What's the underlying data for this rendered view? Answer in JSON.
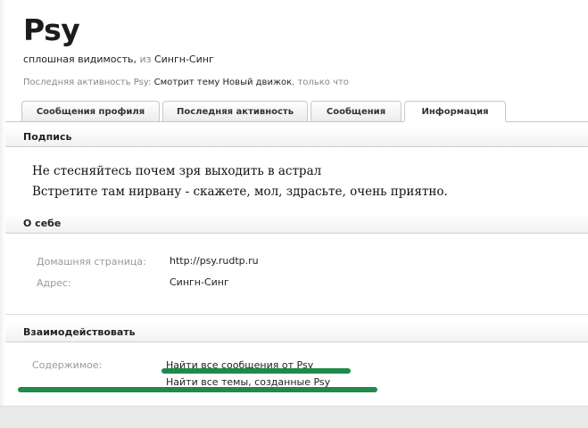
{
  "profile": {
    "username": "Psy",
    "status": "сплошная видимость",
    "from_prefix": "из",
    "location": "Сингн-Синг",
    "last_activity_prefix": "Последняя активность Psy:",
    "last_activity_text": "Смотрит тему Новый движок",
    "last_activity_time": "только что"
  },
  "tabs": [
    {
      "label": "Сообщения профиля",
      "active": false
    },
    {
      "label": "Последняя активность",
      "active": false
    },
    {
      "label": "Сообщения",
      "active": false
    },
    {
      "label": "Информация",
      "active": true
    }
  ],
  "signature": {
    "title": "Подпись",
    "line1": "Не стесняйтесь почем зря выходить в астрал",
    "line2": "Встретите там нирвану - скажете, мол, здрасьте, очень приятно."
  },
  "about": {
    "title": "О себе",
    "homepage_label": "Домашняя страница:",
    "homepage_value": "http://psy.rudtp.ru",
    "address_label": "Адрес:",
    "address_value": "Сингн-Синг"
  },
  "interact": {
    "title": "Взаимодействовать",
    "content_label": "Содержимое:",
    "find_posts": "Найти все сообщения от Psy",
    "find_threads": "Найти все темы, созданные Psy"
  },
  "colors": {
    "marker_green": "#1f8a4c"
  }
}
